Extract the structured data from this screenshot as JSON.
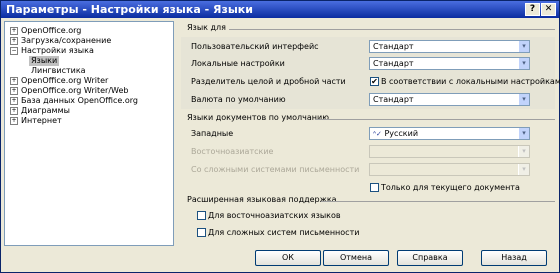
{
  "window": {
    "title": "Параметры - Настройки языка - Языки",
    "help_btn": "?",
    "close_btn": "✕"
  },
  "tree": [
    {
      "label": "OpenOffice.org",
      "expander": "+"
    },
    {
      "label": "Загрузка/сохранение",
      "expander": "+"
    },
    {
      "label": "Настройки языка",
      "expander": "−"
    },
    {
      "label": "Языки",
      "expander": ""
    },
    {
      "label": "Лингвистика",
      "expander": ""
    },
    {
      "label": "OpenOffice.org Writer",
      "expander": "+"
    },
    {
      "label": "OpenOffice.org Writer/Web",
      "expander": "+"
    },
    {
      "label": "База данных OpenOffice.org",
      "expander": "+"
    },
    {
      "label": "Диаграммы",
      "expander": "+"
    },
    {
      "label": "Интернет",
      "expander": "+"
    }
  ],
  "section_language": {
    "title": "Язык для",
    "ui_label": "Пользовательский интерфейс",
    "ui_value": "Стандарт",
    "locale_label": "Локальные настройки",
    "locale_value": "Стандарт",
    "decimal_label": "Разделитель целой и дробной части",
    "decimal_check": "✔",
    "decimal_value": "В соответствии с локальными настройками",
    "currency_label": "Валюта по умолчанию",
    "currency_value": "Стандарт"
  },
  "section_docs": {
    "title": "Языки документов по умолчанию",
    "western_label": "Западные",
    "western_value": "Русский",
    "asian_label": "Восточноазиатские",
    "ctl_label": "Со сложными системами письменности",
    "only_current": "Только для текущего документа"
  },
  "section_ext": {
    "title": "Расширенная языковая поддержка",
    "asian_support": "Для восточноазиатских языков",
    "ctl_support": "Для сложных систем письменности"
  },
  "buttons": {
    "ok": "ОК",
    "cancel": "Отмена",
    "help": "Справка",
    "back": "Назад"
  },
  "icons": {
    "dropdown": "▾",
    "spell": "ᴬ✓"
  }
}
